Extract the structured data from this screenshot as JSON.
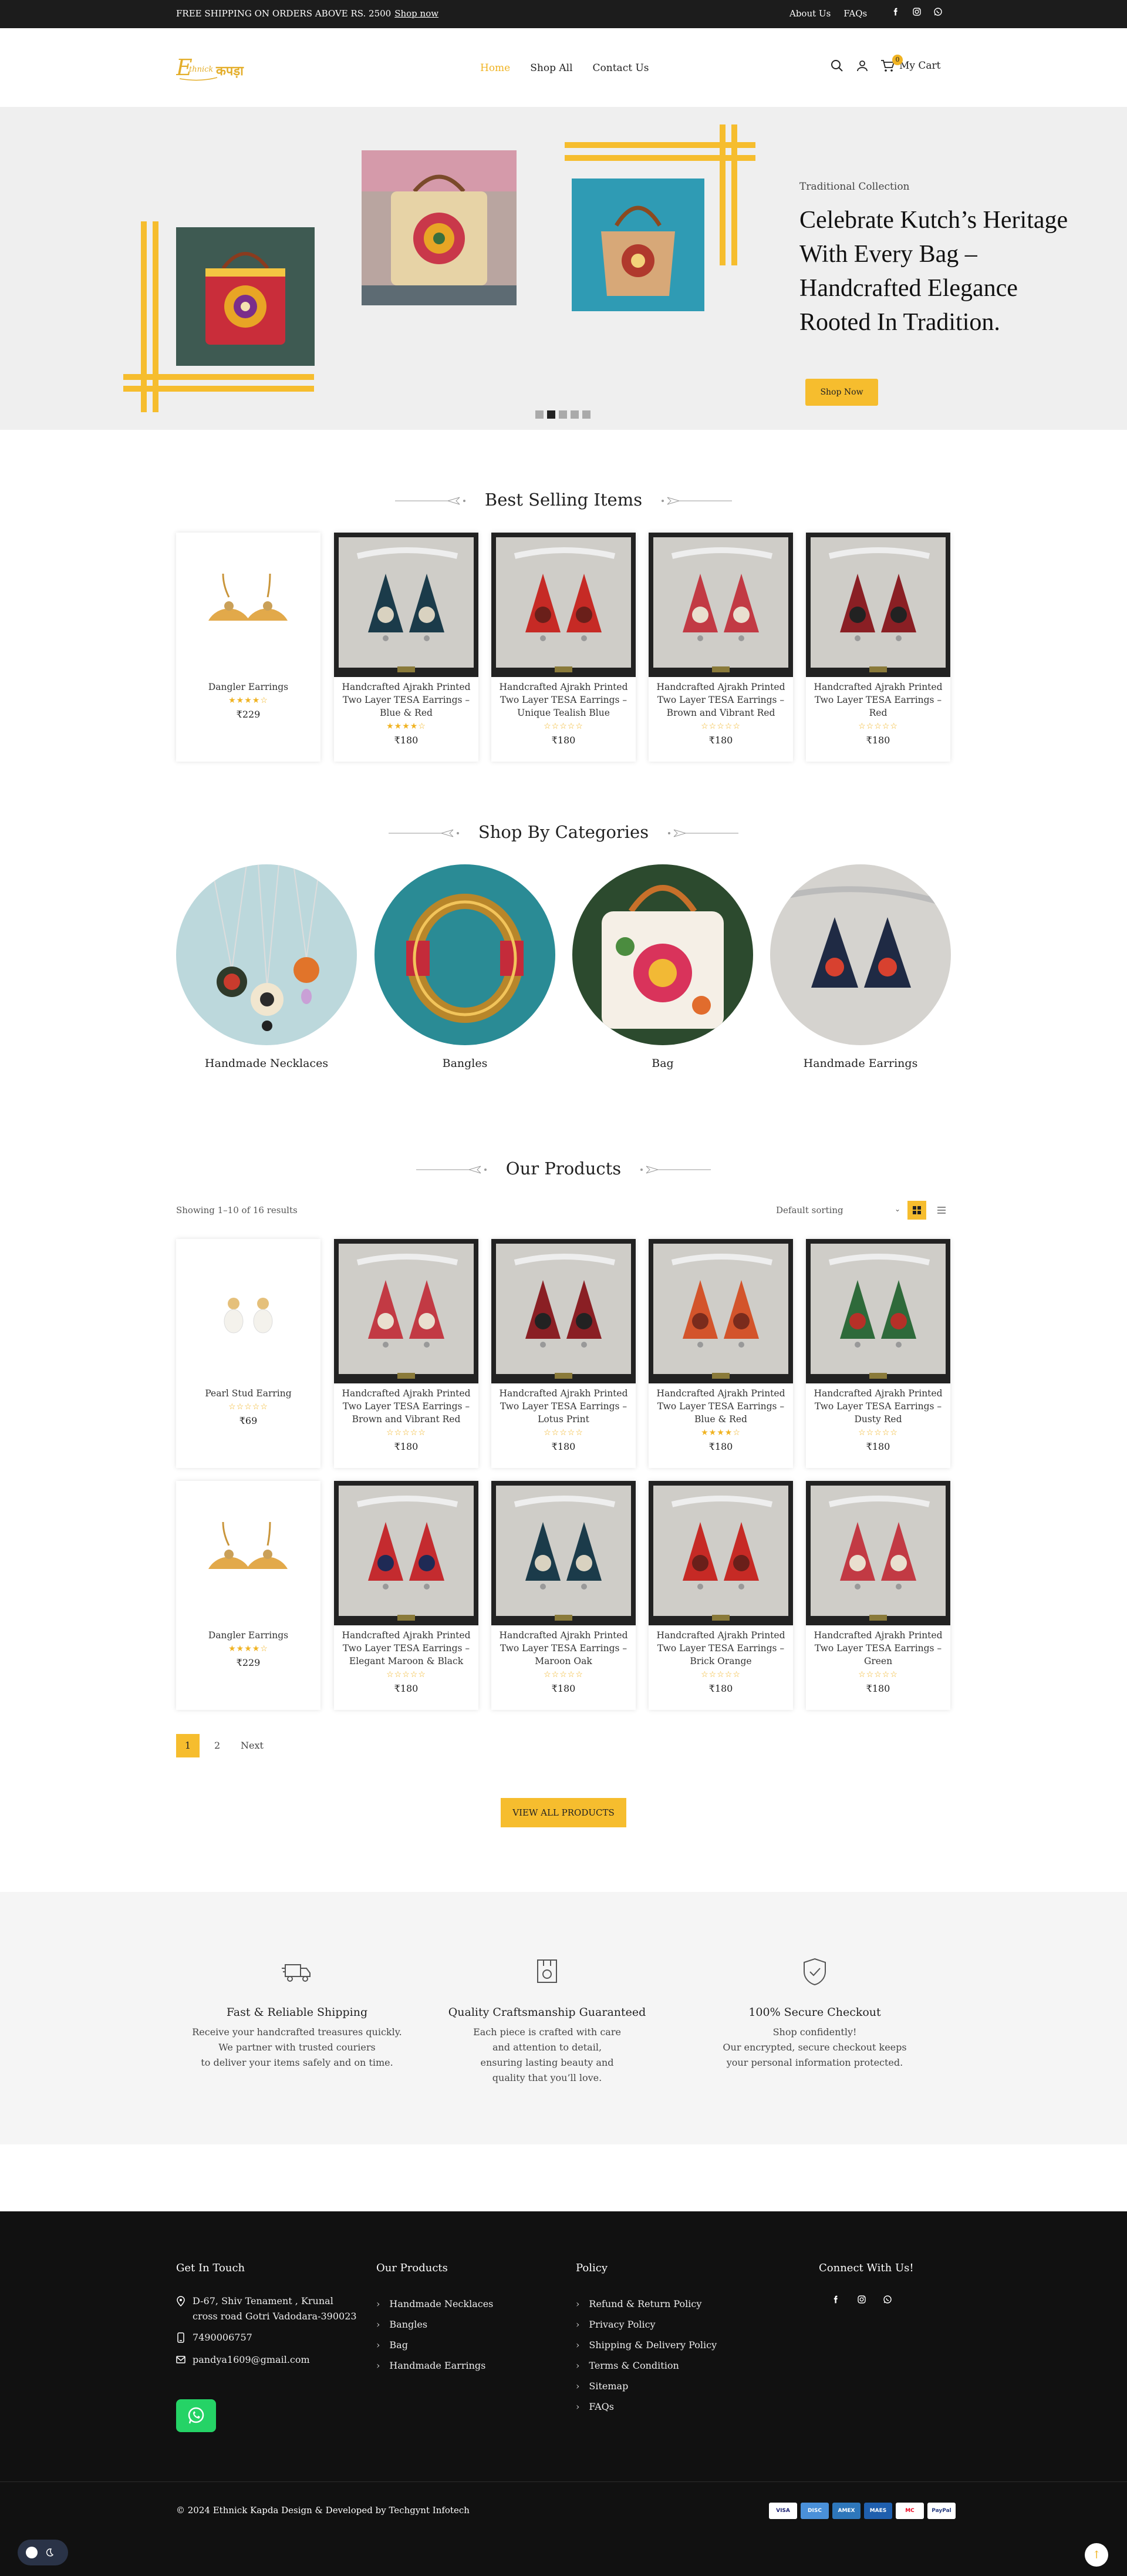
{
  "topbar": {
    "promo": "FREE SHIPPING ON ORDERS ABOVE RS. 2500",
    "promo_link": "Shop now",
    "links": [
      "About Us",
      "FAQs"
    ],
    "social_icons": [
      "facebook-icon",
      "instagram-icon",
      "whatsapp-icon"
    ]
  },
  "header": {
    "logo": "Ethnick Kapda",
    "nav": [
      "Home",
      "Shop All",
      "Contact Us"
    ],
    "active_nav": "Home",
    "cart_label": "My Cart",
    "cart_count": "0"
  },
  "hero": {
    "subtitle": "Traditional Collection",
    "title": "Celebrate Kutch’s Heritage With Every Bag – Handcrafted Elegance Rooted In Tradition.",
    "button": "Shop Now",
    "slides": 5,
    "active_slide": 2,
    "accent": "#f6bd2e"
  },
  "best_selling": {
    "title": "Best Selling Items",
    "items": [
      {
        "name": "Dangler Earrings",
        "rating": 4,
        "price": "₹229"
      },
      {
        "name": "Handcrafted Ajrakh Printed Two Layer TESA Earrings – Blue & Red",
        "rating": 4,
        "price": "₹180"
      },
      {
        "name": "Handcrafted Ajrakh Printed Two Layer TESA Earrings – Unique Tealish Blue",
        "rating": 0,
        "price": "₹180"
      },
      {
        "name": "Handcrafted Ajrakh Printed Two Layer TESA Earrings – Brown and Vibrant Red",
        "rating": 0,
        "price": "₹180"
      },
      {
        "name": "Handcrafted Ajrakh Printed Two Layer TESA Earrings – Red",
        "rating": 0,
        "price": "₹180"
      }
    ]
  },
  "categories": {
    "title": "Shop By Categories",
    "items": [
      "Handmade Necklaces",
      "Bangles",
      "Bag",
      "Handmade Earrings"
    ]
  },
  "products": {
    "title": "Our Products",
    "results": "Showing 1–10 of 16 results",
    "sorting": "Default sorting",
    "items": [
      {
        "name": "Pearl Stud Earring",
        "rating": 0,
        "price": "₹69"
      },
      {
        "name": "Handcrafted Ajrakh Printed Two Layer TESA Earrings – Brown and Vibrant Red",
        "rating": 0,
        "price": "₹180"
      },
      {
        "name": "Handcrafted Ajrakh Printed Two Layer TESA Earrings – Lotus Print",
        "rating": 0,
        "price": "₹180"
      },
      {
        "name": "Handcrafted Ajrakh Printed Two Layer TESA Earrings – Blue & Red",
        "rating": 4,
        "price": "₹180"
      },
      {
        "name": "Handcrafted Ajrakh Printed Two Layer TESA Earrings – Dusty Red",
        "rating": 0,
        "price": "₹180"
      },
      {
        "name": "Dangler Earrings",
        "rating": 4,
        "price": "₹229"
      },
      {
        "name": "Handcrafted Ajrakh Printed Two Layer TESA Earrings – Elegant Maroon & Black",
        "rating": 0,
        "price": "₹180"
      },
      {
        "name": "Handcrafted Ajrakh Printed Two Layer TESA Earrings – Maroon Oak",
        "rating": 0,
        "price": "₹180"
      },
      {
        "name": "Handcrafted Ajrakh Printed Two Layer TESA Earrings – Brick Orange",
        "rating": 0,
        "price": "₹180"
      },
      {
        "name": "Handcrafted Ajrakh Printed Two Layer TESA Earrings – Green",
        "rating": 0,
        "price": "₹180"
      }
    ],
    "pagination": {
      "current": "1",
      "next_page": "2",
      "next_label": "Next"
    },
    "view_all": "VIEW ALL PRODUCTS"
  },
  "features": [
    {
      "title": "Fast & Reliable Shipping",
      "text": [
        "Receive your handcrafted treasures quickly.",
        "We partner with trusted couriers",
        "to deliver your items safely and on time."
      ]
    },
    {
      "title": "Quality Craftsmanship Guaranteed",
      "text": [
        "Each piece is crafted with care",
        "and attention to detail,",
        "ensuring lasting beauty and",
        "quality that you’ll love."
      ]
    },
    {
      "title": "100% Secure Checkout",
      "text": [
        "Shop confidently!",
        "Our encrypted, secure checkout keeps",
        "your personal information protected."
      ]
    }
  ],
  "footer": {
    "contact_title": "Get In Touch",
    "address": [
      "D-67, Shiv Tenament , Krunal",
      "cross road Gotri Vadodara-390023"
    ],
    "phone": "7490006757",
    "email": "pandya1609@gmail.com",
    "products_title": "Our Products",
    "products_links": [
      "Handmade Necklaces",
      "Bangles",
      "Bag",
      "Handmade Earrings"
    ],
    "policy_title": "Policy",
    "policy_links": [
      "Refund & Return Policy",
      "Privacy Policy",
      "Shipping & Delivery Policy",
      "Terms & Condition",
      "Sitemap",
      "FAQs"
    ],
    "connect_title": "Connect With Us!",
    "copyright": "© 2024 Ethnick Kapda Design & Developed by Techgynt Infotech",
    "payments": [
      "VISA",
      "DISC",
      "AMEX",
      "MAES",
      "MC",
      "PayPal"
    ]
  }
}
